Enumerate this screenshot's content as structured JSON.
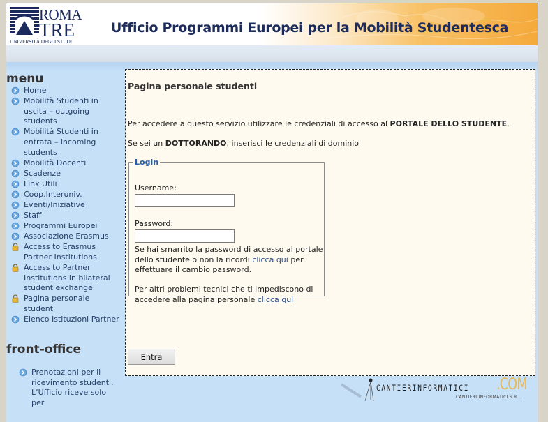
{
  "header": {
    "logo": {
      "line1": "ROMA",
      "line2": "TRE",
      "line3": "UNIVERSITÀ DEGLI STUDI"
    },
    "title": "Ufficio Programmi Europei per la Mobilità Studentesca"
  },
  "sidebar": {
    "menu_title": "menu",
    "items": [
      {
        "label": "Home",
        "icon": "arrow-bullet-icon"
      },
      {
        "label": "Mobilità Studenti in uscita – outgoing students",
        "icon": "arrow-bullet-icon"
      },
      {
        "label": "Mobilità Studenti in entrata – incoming students",
        "icon": "arrow-bullet-icon"
      },
      {
        "label": "Mobilità Docenti",
        "icon": "arrow-bullet-icon"
      },
      {
        "label": "Scadenze",
        "icon": "arrow-bullet-icon"
      },
      {
        "label": "Link Utili",
        "icon": "arrow-bullet-icon"
      },
      {
        "label": "Coop.Interuniv.",
        "icon": "arrow-bullet-icon"
      },
      {
        "label": "Eventi/Iniziative",
        "icon": "arrow-bullet-icon"
      },
      {
        "label": "Staff",
        "icon": "arrow-bullet-icon"
      },
      {
        "label": "Programmi Europei",
        "icon": "arrow-bullet-icon"
      },
      {
        "label": "Associazione Erasmus",
        "icon": "arrow-bullet-icon"
      },
      {
        "label": "Access to Erasmus Partner Institutions",
        "icon": "lock-icon"
      },
      {
        "label": "Access to Partner Institutions in bilateral student exchange",
        "icon": "lock-icon"
      },
      {
        "label": "Pagina personale studenti",
        "icon": "lock-icon"
      },
      {
        "label": "Elenco Istituzioni Partner",
        "icon": "arrow-bullet-icon"
      }
    ],
    "front_office_title": "front-office",
    "front_office_items": [
      {
        "label": "Prenotazioni per il ricevimento studenti.  L’Ufficio riceve solo per",
        "icon": "arrow-bullet-icon"
      }
    ]
  },
  "content": {
    "page_title": "Pagina personale studenti",
    "para1_prefix": "Per accedere a questo servizio utilizzare le credenziali di accesso al ",
    "para1_bold": "PORTALE DELLO STUDENTE",
    "para1_suffix": ".",
    "para2_prefix": "Se sei un ",
    "para2_bold": "DOTTORANDO",
    "para2_suffix": ", inserisci le credenziali di dominio",
    "login": {
      "legend": "Login",
      "username_label": "Username:",
      "username_value": "",
      "password_label": "Password:",
      "password_value": "",
      "help1_text": "Se hai smarrito la password di accesso al portale dello studente o non la ricordi ",
      "help1_link": "clicca qui",
      "help1_suffix": " per effettuare il cambio password.",
      "help2_text": "Per altri problemi tecnici che ti impediscono di accedere alla pagina personale ",
      "help2_link": "clicca qui"
    },
    "submit_label": "Entra"
  },
  "footer": {
    "brand": "CANTIERINFORMATICI",
    "brand_suffix": ".COM",
    "brand_sub": "CANTIERI INFORMATICI S.R.L."
  },
  "colors": {
    "sidebar_bg": "#c6e0f8",
    "content_bg": "#fffaef",
    "link": "#2a4f8a",
    "legend": "#2a5ea8",
    "title": "#1c2b5a",
    "header_orange": "#f5a93a"
  }
}
